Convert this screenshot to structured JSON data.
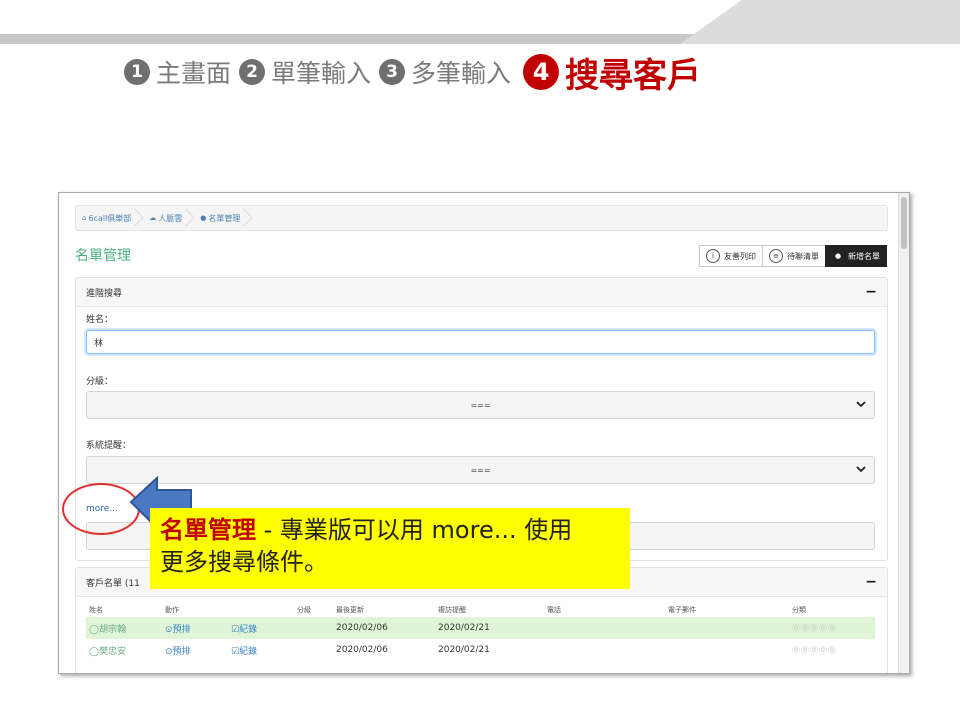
{
  "slide": {
    "steps": [
      {
        "num": "1",
        "label": "主畫面"
      },
      {
        "num": "2",
        "label": "單筆輸入"
      },
      {
        "num": "3",
        "label": "多筆輸入"
      },
      {
        "num": "4",
        "label": "搜尋客戶"
      }
    ],
    "active_step": 3,
    "colors": {
      "active": "#c00000",
      "inactive": "#7a7a7a",
      "callout": "#ffff00"
    }
  },
  "app": {
    "breadcrumb": [
      {
        "icon": "home-icon",
        "label": "6call俱樂部"
      },
      {
        "icon": "cloud-icon",
        "label": "人脈雲"
      },
      {
        "icon": "users-icon",
        "label": "名單管理"
      }
    ],
    "page_title": "名單管理",
    "buttons": [
      {
        "icon": "info-icon",
        "label": "友善列印"
      },
      {
        "icon": "list-icon",
        "label": "待聯清單"
      },
      {
        "icon": "user-icon",
        "label": "新增名單"
      }
    ],
    "search_panel": {
      "title": "進階搜尋",
      "collapse": "−",
      "name_label": "姓名：",
      "name_value": "林",
      "grade_label": "分級：",
      "grade_value": "===",
      "reminder_label": "系統提醒：",
      "reminder_value": "===",
      "more_link": "more..."
    },
    "list_panel": {
      "title": "客戶名單 (11",
      "collapse": "−",
      "columns": [
        "姓名",
        "動作",
        "",
        "分級",
        "最後更新",
        "複訪提醒",
        "電話",
        "電子郵件",
        "分類"
      ],
      "rows": [
        {
          "name": "胡宗翰",
          "schedule": "⊙預排",
          "record": "☑紀錄",
          "grade": "",
          "updated": "2020/02/06",
          "reminder": "2020/02/21",
          "phone": "",
          "email": "",
          "category": "⓪⓪⓪⓪⓪"
        },
        {
          "name": "樊忠安",
          "schedule": "⊙預排",
          "record": "☑紀錄",
          "grade": "",
          "updated": "2020/02/06",
          "reminder": "2020/02/21",
          "phone": "",
          "email": "",
          "category": "⓪⓪⓪⓪⓪"
        }
      ]
    }
  },
  "callout": {
    "highlight": "名單管理",
    "line1": " - 專業版可以用 more... 使用",
    "line2": "更多搜尋條件。"
  }
}
